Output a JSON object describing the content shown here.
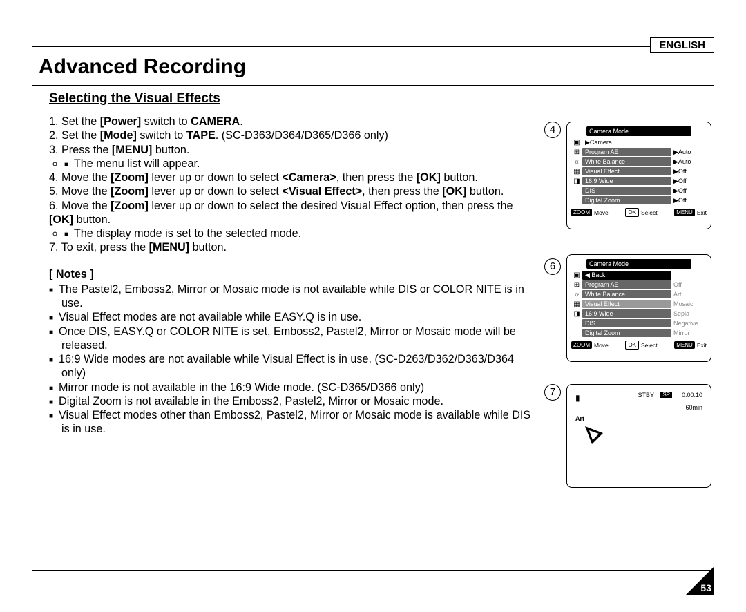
{
  "lang": "ENGLISH",
  "title": "Advanced Recording",
  "subtitle": "Selecting the Visual Effects",
  "step1a": "1. Set the ",
  "step1b": "[Power]",
  "step1c": " switch to ",
  "step1d": "CAMERA",
  "step1e": ".",
  "step2a": "2. Set the ",
  "step2b": "[Mode]",
  "step2c": " switch to ",
  "step2d": "TAPE",
  "step2e": ". (SC-D363/D364/D365/D366 only)",
  "step3a": "3. Press the ",
  "step3b": "[MENU]",
  "step3c": " button.",
  "step3sub": "The menu list will appear.",
  "step4a": "4. Move the ",
  "step4b": "[Zoom]",
  "step4c": " lever up or down to select ",
  "step4d": "<Camera>",
  "step4e": ", then press the ",
  "step4f": "[OK]",
  "step4g": " button.",
  "step5a": "5. Move the ",
  "step5b": "[Zoom]",
  "step5c": " lever up or down to select ",
  "step5d": "<Visual Effect>",
  "step5e": ", then press the ",
  "step5f": "[OK]",
  "step5g": " button.",
  "step6a": "6. Move the ",
  "step6b": "[Zoom]",
  "step6c": " lever up or down to select the desired Visual Effect option, then press the ",
  "step6d": "[OK]",
  "step6e": " button.",
  "step6sub": "The display mode is set to the selected mode.",
  "step7a": "7. To exit, press the ",
  "step7b": "[MENU]",
  "step7c": " button.",
  "notes_h": "[ Notes ]",
  "note1": "The Pastel2, Emboss2, Mirror or Mosaic mode is not available while DIS or COLOR NITE is in use.",
  "note2": "Visual Effect modes are not available while EASY.Q is in use.",
  "note3": "Once DIS, EASY.Q or COLOR NITE is set, Emboss2, Pastel2, Mirror or Mosaic mode will be released.",
  "note4": "16:9 Wide modes are not available while Visual Effect is in use. (SC-D263/D362/D363/D364 only)",
  "note5": "Mirror mode is not available in the 16:9 Wide mode. (SC-D365/D366 only)",
  "note6": "Digital Zoom is not available in the Emboss2, Pastel2, Mirror or Mosaic mode.",
  "note7": "Visual Effect modes other than Emboss2, Pastel2, Mirror or Mosaic mode is available while DIS is in use.",
  "fig4_num": "4",
  "fig6_num": "6",
  "fig7_num": "7",
  "osd4": {
    "title": "Camera Mode",
    "back": "▶Camera",
    "r1l": "Program AE",
    "r1v": "▶Auto",
    "r2l": "White Balance",
    "r2v": "▶Auto",
    "r3l": "Visual Effect",
    "r3v": "▶Off",
    "r4l": "16:9 Wide",
    "r4v": "▶Off",
    "r5l": "DIS",
    "r5v": "▶Off",
    "r6l": "Digital Zoom",
    "r6v": "▶Off"
  },
  "osd6": {
    "title": "Camera Mode",
    "back": "◀ Back",
    "r1l": "Program AE",
    "r1v": "Off",
    "r2l": "White Balance",
    "r2v": "Art",
    "r3l": "Visual Effect",
    "r3v": "Mosaic",
    "r4l": "16:9 Wide",
    "r4v": "Sepia",
    "r5l": "DIS",
    "r5v": "Negative",
    "r6l": "Digital Zoom",
    "r6v": "Mirror"
  },
  "osd_footer": {
    "zoom": "ZOOM",
    "move": "Move",
    "ok": "OK",
    "select": "Select",
    "menu": "MENU",
    "exit": "Exit"
  },
  "osd7": {
    "stby": "STBY",
    "sp": "SP",
    "time": "0:00:10",
    "min": "60min",
    "art": "Art"
  },
  "page_num": "53"
}
